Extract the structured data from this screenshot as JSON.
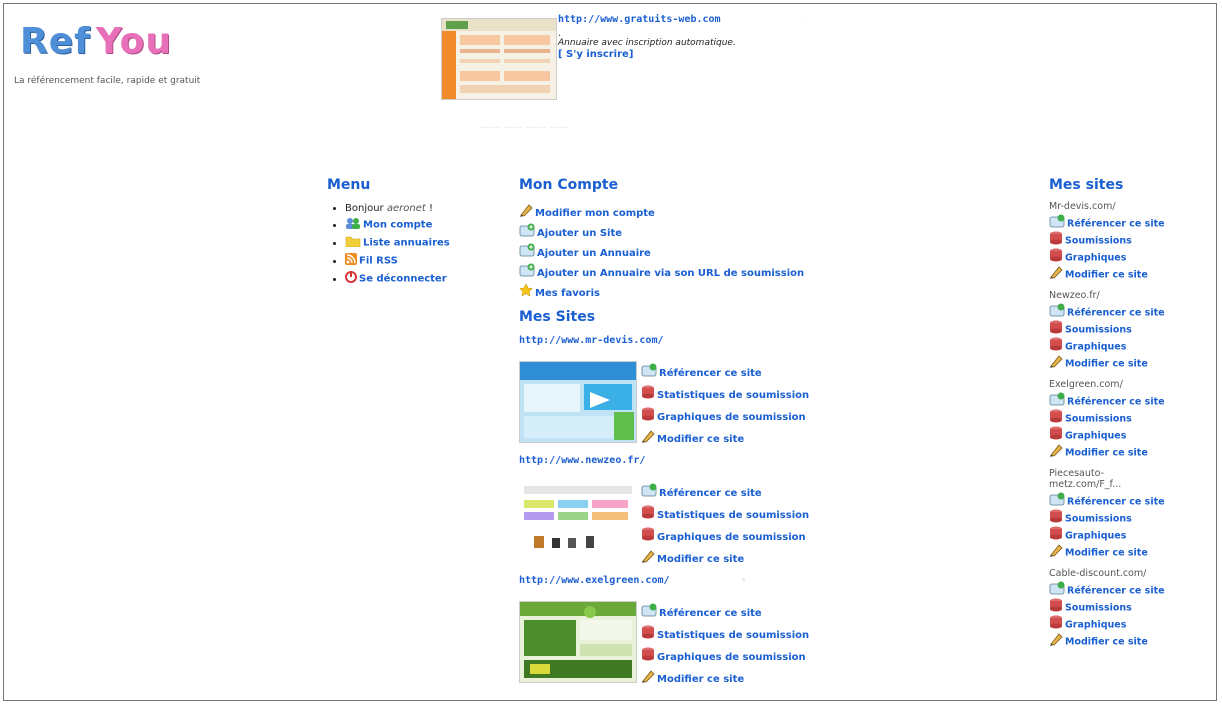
{
  "header": {
    "logo_ref": "Ref",
    "logo_you": "You",
    "tagline": "La référencement facile, rapide et gratuit",
    "banner": {
      "url": "http://www.gratuits-web.com",
      "dot": ".",
      "description": "Annuaire avec inscription automatique.",
      "signup": "[ S'y inscrire]"
    }
  },
  "menu": {
    "title": "Menu",
    "greeting": "Bonjour",
    "username": "aeronet",
    "greeting_suffix": "!",
    "items": [
      {
        "label": "Mon compte",
        "icon": "users-icon"
      },
      {
        "label": "Liste annuaires",
        "icon": "folder-icon"
      },
      {
        "label": "Fil RSS",
        "icon": "rss-icon"
      },
      {
        "label": "Se déconnecter",
        "icon": "logout-icon"
      }
    ]
  },
  "account": {
    "title": "Mon Compte",
    "items": [
      {
        "label": "Modifier mon compte",
        "icon": "pencil-icon"
      },
      {
        "label": "Ajouter un Site",
        "icon": "add-site-icon"
      },
      {
        "label": "Ajouter un Annuaire",
        "icon": "add-directory-icon"
      },
      {
        "label": "Ajouter un Annuaire via son URL de soumission",
        "icon": "add-url-icon"
      },
      {
        "label": "Mes favoris",
        "icon": "star-icon"
      }
    ]
  },
  "sites_section": {
    "title": "Mes Sites",
    "actions": [
      "Référencer ce site",
      "Statistiques de soumission",
      "Graphiques de soumission",
      "Modifier ce site"
    ],
    "sites": [
      {
        "url": "http://www.mr-devis.com/"
      },
      {
        "url": "http://www.newzeo.fr/"
      },
      {
        "url": "http://www.exelgreen.com/"
      }
    ]
  },
  "right_panel": {
    "title": "Mes sites",
    "actions": [
      "Référencer ce site",
      "Soumissions",
      "Graphiques",
      "Modifier ce site"
    ],
    "sites": [
      {
        "name": "Mr-devis.com/"
      },
      {
        "name": "Newzeo.fr/"
      },
      {
        "name": "Exelgreen.com/"
      },
      {
        "name": "Piecesauto-metz.com/F_f..."
      },
      {
        "name": "Cable-discount.com/"
      }
    ]
  },
  "colors": {
    "link": "#1a5fd1",
    "logo_blue": "#4f8fd8",
    "logo_pink": "#e870b8"
  }
}
